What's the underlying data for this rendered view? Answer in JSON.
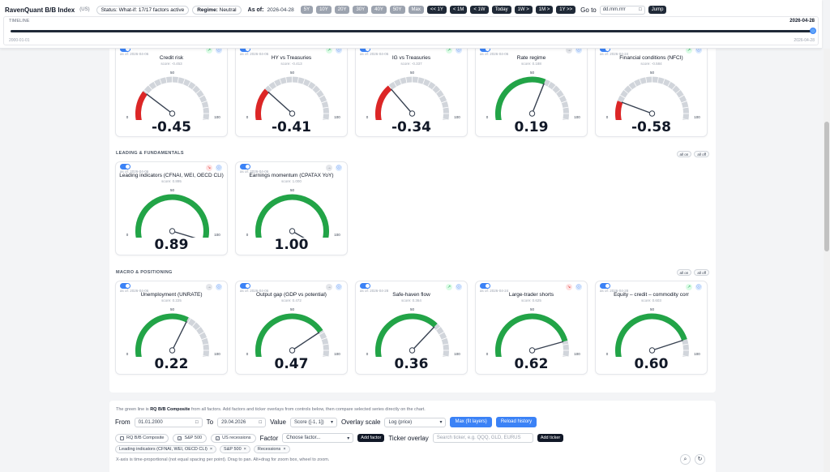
{
  "header": {
    "title": "RavenQuant B/B Index",
    "subtitle": "(US)",
    "status": "Status: What-if: 17/17 factors active",
    "regime_label": "Regime:",
    "regime_value": "Neutral",
    "asof_label": "As of:",
    "asof_value": "2026-04-28",
    "range_buttons": [
      "5Y",
      "10Y",
      "20Y",
      "30Y",
      "40Y",
      "50Y",
      "Max"
    ],
    "nav_buttons": [
      "<< 1Y",
      "< 1M",
      "< 1W",
      "Today",
      "1W >",
      "1M >",
      "1Y >>"
    ],
    "goto_label": "Go to",
    "goto_placeholder": "dd.mm.rrrr",
    "jump_label": "Jump"
  },
  "timeline": {
    "label": "TIMELINE",
    "end_date": "2026-04-28",
    "start_small": "2000-01-01",
    "end_small": "2026-04-28",
    "position": 1.0
  },
  "sections": {
    "leading": {
      "title": "LEADING & FUNDAMENTALS",
      "all_on": "all on",
      "all_off": "all off"
    },
    "macro": {
      "title": "MACRO & POSITIONING",
      "all_on": "all on",
      "all_off": "all off"
    }
  },
  "gauge_labels": {
    "min": "0",
    "mid": "50",
    "max": "100"
  },
  "cards": [
    {
      "name": "Credit risk",
      "asof": "as of: 2026-04-06",
      "score": "score: -0.453",
      "value": "-0.45",
      "level": 0.28,
      "color": "#dc2626",
      "trend": "up",
      "trend_icon": "↗"
    },
    {
      "name": "HY vs Treasuries",
      "asof": "as of: 2026-04-06",
      "score": "score: -0.413",
      "value": "-0.41",
      "level": 0.3,
      "color": "#dc2626",
      "trend": "up",
      "trend_icon": "↗"
    },
    {
      "name": "IG vs Treasuries",
      "asof": "as of: 2026-04-06",
      "score": "score: -0.337",
      "value": "-0.34",
      "level": 0.33,
      "color": "#dc2626",
      "trend": "up",
      "trend_icon": "↗"
    },
    {
      "name": "Rate regime",
      "asof": "as of: 2026-04-06",
      "score": "score: 0.188",
      "value": "0.19",
      "level": 0.59,
      "color": "#22a447",
      "trend": "flat",
      "trend_icon": "→"
    },
    {
      "name": "Financial conditions (NFCI)",
      "asof": "as of: 2026-04-24",
      "score": "score: -0.584",
      "value": "-0.58",
      "level": 0.21,
      "color": "#dc2626",
      "trend": "up",
      "trend_icon": "↗"
    },
    {
      "name": "Leading indicators (CFNAI, WEI, OECD CLI)",
      "asof": "as of: 2026-04-06",
      "score": "score: 0.895",
      "value": "0.89",
      "level": 0.945,
      "color": "#22a447",
      "trend": "down",
      "trend_icon": "↘"
    },
    {
      "name": "Earnings momentum (CPATAX YoY)",
      "asof": "as of: 2026-04-06",
      "score": "score: 1.000",
      "value": "1.00",
      "level": 1.0,
      "color": "#22a447",
      "trend": "flat",
      "trend_icon": "→"
    },
    {
      "name": "Unemployment (UNRATE)",
      "asof": "as of: 2026-04-06",
      "score": "score: 0.225",
      "value": "0.22",
      "level": 0.61,
      "color": "#22a447",
      "trend": "flat",
      "trend_icon": "→"
    },
    {
      "name": "Output gap (GDP vs potential)",
      "asof": "as of: 2026-04-06",
      "score": "score: 0.472",
      "value": "0.47",
      "level": 0.735,
      "color": "#22a447",
      "trend": "flat",
      "trend_icon": "→"
    },
    {
      "name": "Safe-haven flow",
      "asof": "as of: 2026-04-28",
      "score": "score: 0.364",
      "value": "0.36",
      "level": 0.68,
      "color": "#22a447",
      "trend": "up",
      "trend_icon": "↗"
    },
    {
      "name": "Large-trader shorts",
      "asof": "as of: 2026-04-24",
      "score": "score: 0.625",
      "value": "0.62",
      "level": 0.81,
      "color": "#22a447",
      "trend": "down",
      "trend_icon": "↘"
    },
    {
      "name": "Equity – credit – commodity corr",
      "asof": "as of: 2026-04-28",
      "score": "score: 0.603",
      "value": "0.60",
      "level": 0.8,
      "color": "#22a447",
      "trend": "up",
      "trend_icon": "↗"
    }
  ],
  "controls": {
    "note_prefix": "The green line is",
    "note_bold": "RQ B/B Composite",
    "note_suffix": "from all factors. Add factors and ticker overlays from controls below, then compare selected series directly on the chart.",
    "from_label": "From",
    "from_value": "01.01.2000",
    "to_label": "To",
    "to_value": "29.04.2026",
    "value_label": "Value",
    "value_select": "Score ([-1, 1])",
    "overlay_label": "Overlay scale",
    "overlay_select": "Log (price)",
    "max_btn": "Max (fit layers)",
    "reload_btn": "Reload history",
    "chk_composite": "RQ B/B Composite",
    "chk_sp500": "S&P 500",
    "chk_recessions": "US recessions",
    "factor_label": "Factor",
    "factor_select": "Choose factor...",
    "add_factor": "Add factor",
    "ticker_label": "Ticker overlay",
    "ticker_placeholder": "Search ticker, e.g. QQQ, GLD, EURUS",
    "add_ticker": "Add ticker",
    "tags": [
      "Leading indicators (CFNAI, WEI, OECD CLI)",
      "S&P 500",
      "Recessions"
    ],
    "footer": "X-axis is time-proportional (not equal spacing per point). Drag to pan. Alt+drag for zoom box, wheel to zoom."
  }
}
